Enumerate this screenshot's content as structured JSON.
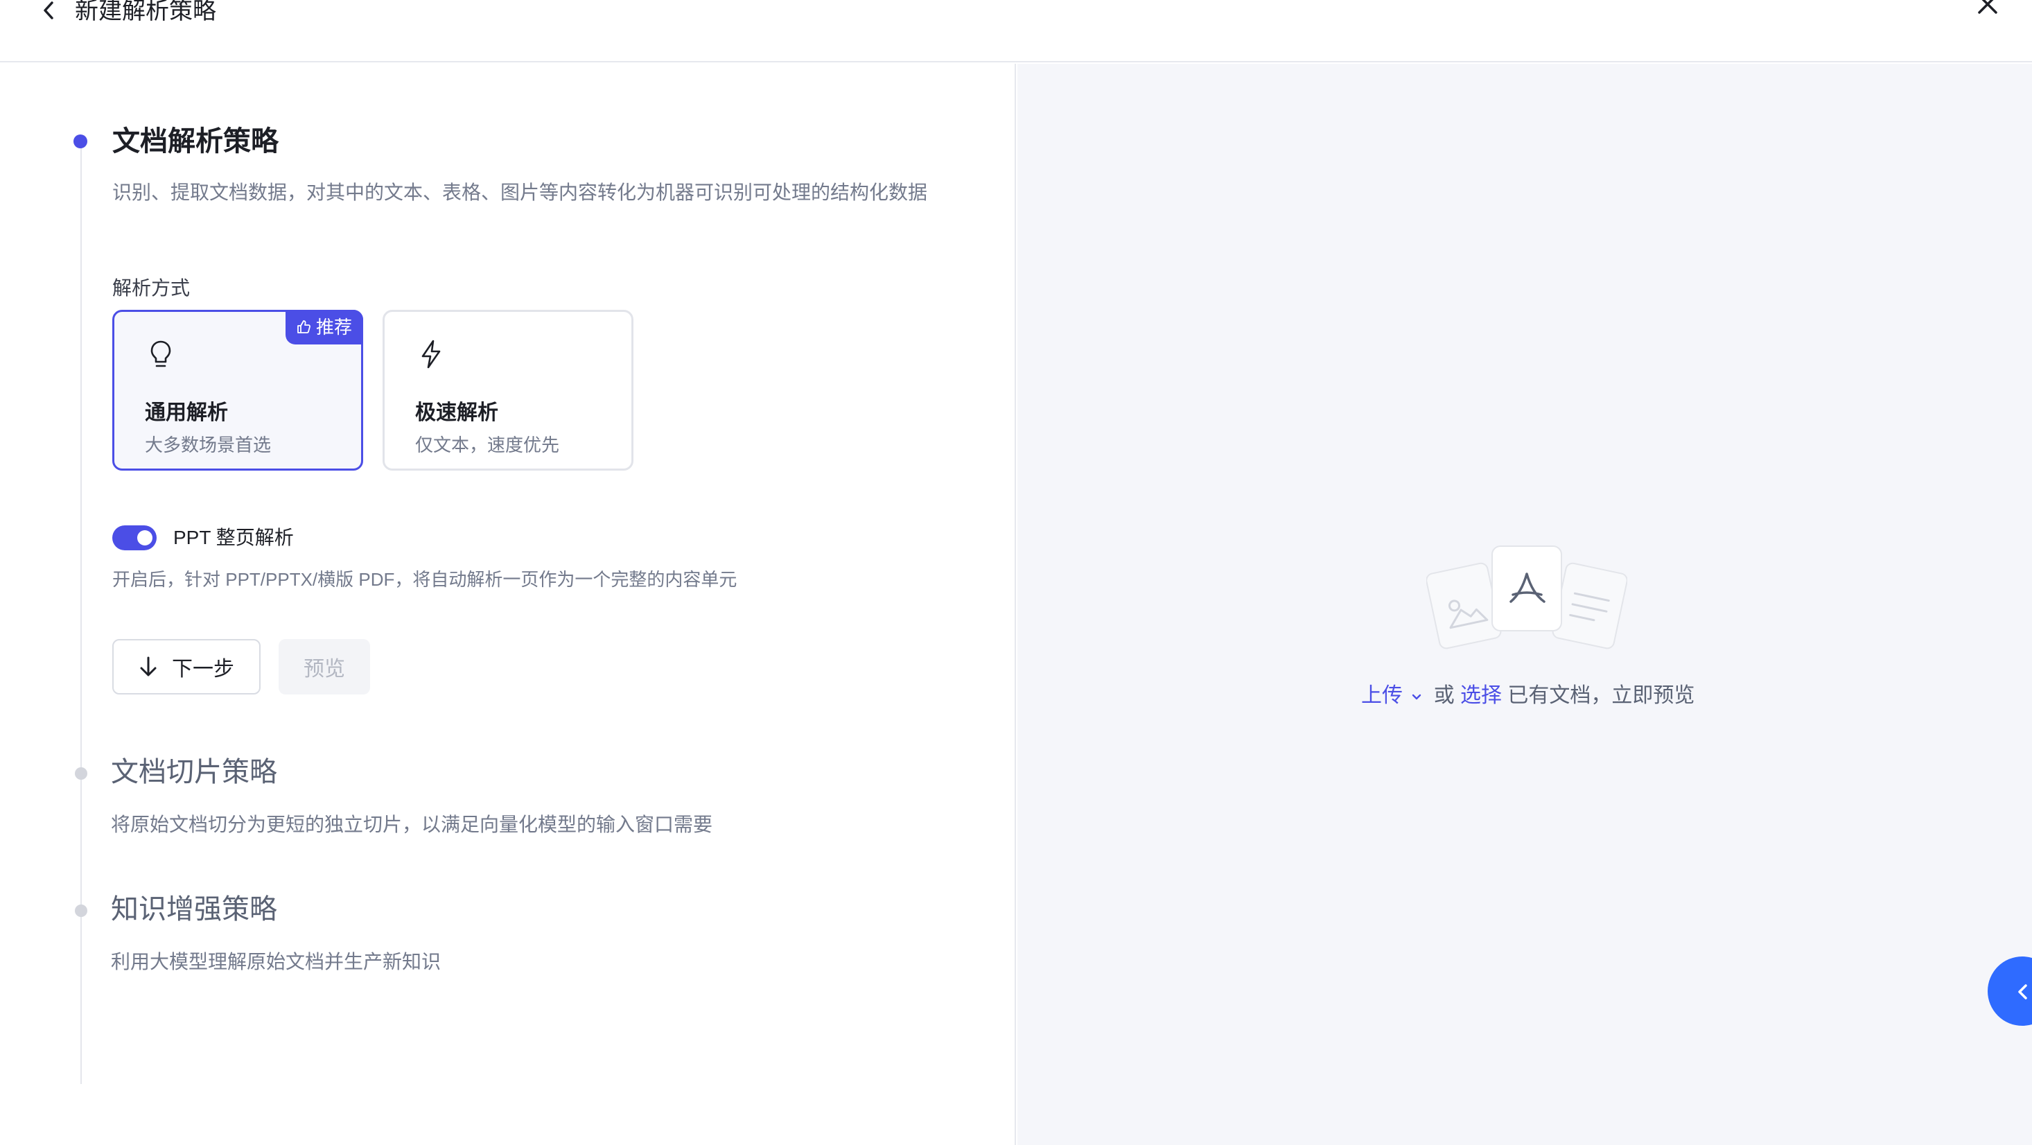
{
  "header": {
    "title": "新建解析策略"
  },
  "sections": [
    {
      "title": "文档解析策略",
      "description": "识别、提取文档数据，对其中的文本、表格、图片等内容转化为机器可识别可处理的结构化数据"
    },
    {
      "title": "文档切片策略",
      "description": "将原始文档切分为更短的独立切片，以满足向量化模型的输入窗口需要"
    },
    {
      "title": "知识增强策略",
      "description": "利用大模型理解原始文档并生产新知识"
    }
  ],
  "parse_method": {
    "label": "解析方式",
    "options": [
      {
        "title": "通用解析",
        "subtitle": "大多数场景首选",
        "icon": "lightbulb-icon",
        "badge": "推荐",
        "selected": true
      },
      {
        "title": "极速解析",
        "subtitle": "仅文本，速度优先",
        "icon": "lightning-icon",
        "selected": false
      }
    ]
  },
  "ppt_toggle": {
    "label": "PPT 整页解析",
    "enabled": true,
    "description": "开启后，针对 PPT/PPTX/横版 PDF，将自动解析一页作为一个完整的内容单元"
  },
  "actions": {
    "next_label": "下一步",
    "preview_label": "预览"
  },
  "preview_panel": {
    "upload_link": "上传",
    "or_text": "或",
    "select_link": "选择",
    "suffix_text": "已有文档，立即预览"
  },
  "colors": {
    "accent": "#4b4ee6",
    "side_tab": "#2f6bff",
    "panel_bg": "#f5f6fa"
  }
}
